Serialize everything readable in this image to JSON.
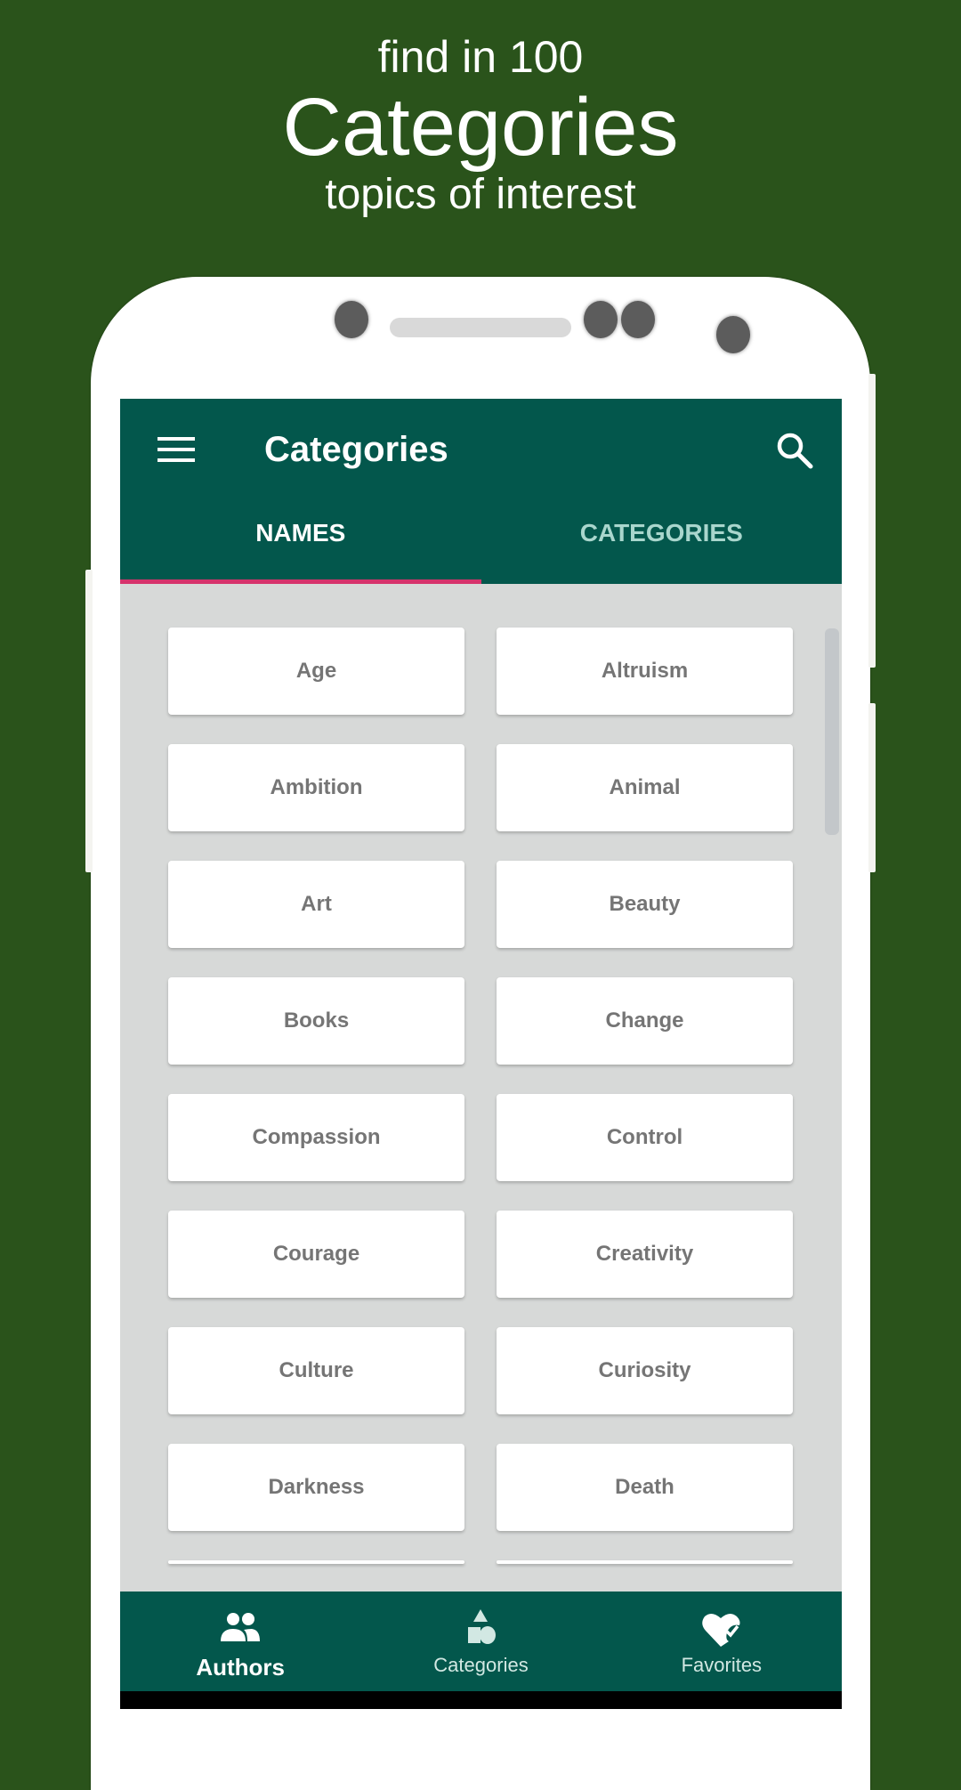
{
  "promo": {
    "line1": "find in 100",
    "title": "Categories",
    "line3": "topics of interest"
  },
  "appbar": {
    "title": "Categories",
    "menu_icon": "hamburger-menu-icon",
    "search_icon": "search-icon"
  },
  "tabs": [
    {
      "label": "NAMES",
      "active": true
    },
    {
      "label": "CATEGORIES",
      "active": false
    }
  ],
  "grid": {
    "items": [
      "Age",
      "Altruism",
      "Ambition",
      "Animal",
      "Art",
      "Beauty",
      "Books",
      "Change",
      "Compassion",
      "Control",
      "Courage",
      "Creativity",
      "Culture",
      "Curiosity",
      "Darkness",
      "Death"
    ]
  },
  "bottom_nav": [
    {
      "label": "Authors",
      "icon": "people-icon",
      "active": true
    },
    {
      "label": "Categories",
      "icon": "shapes-icon",
      "active": false
    },
    {
      "label": "Favorites",
      "icon": "heart-check-icon",
      "active": false
    }
  ],
  "colors": {
    "background": "#2a531b",
    "primary": "#03574c",
    "tab_indicator": "#d6336c",
    "list_background": "#d7d9d8",
    "card_text": "#757575"
  }
}
